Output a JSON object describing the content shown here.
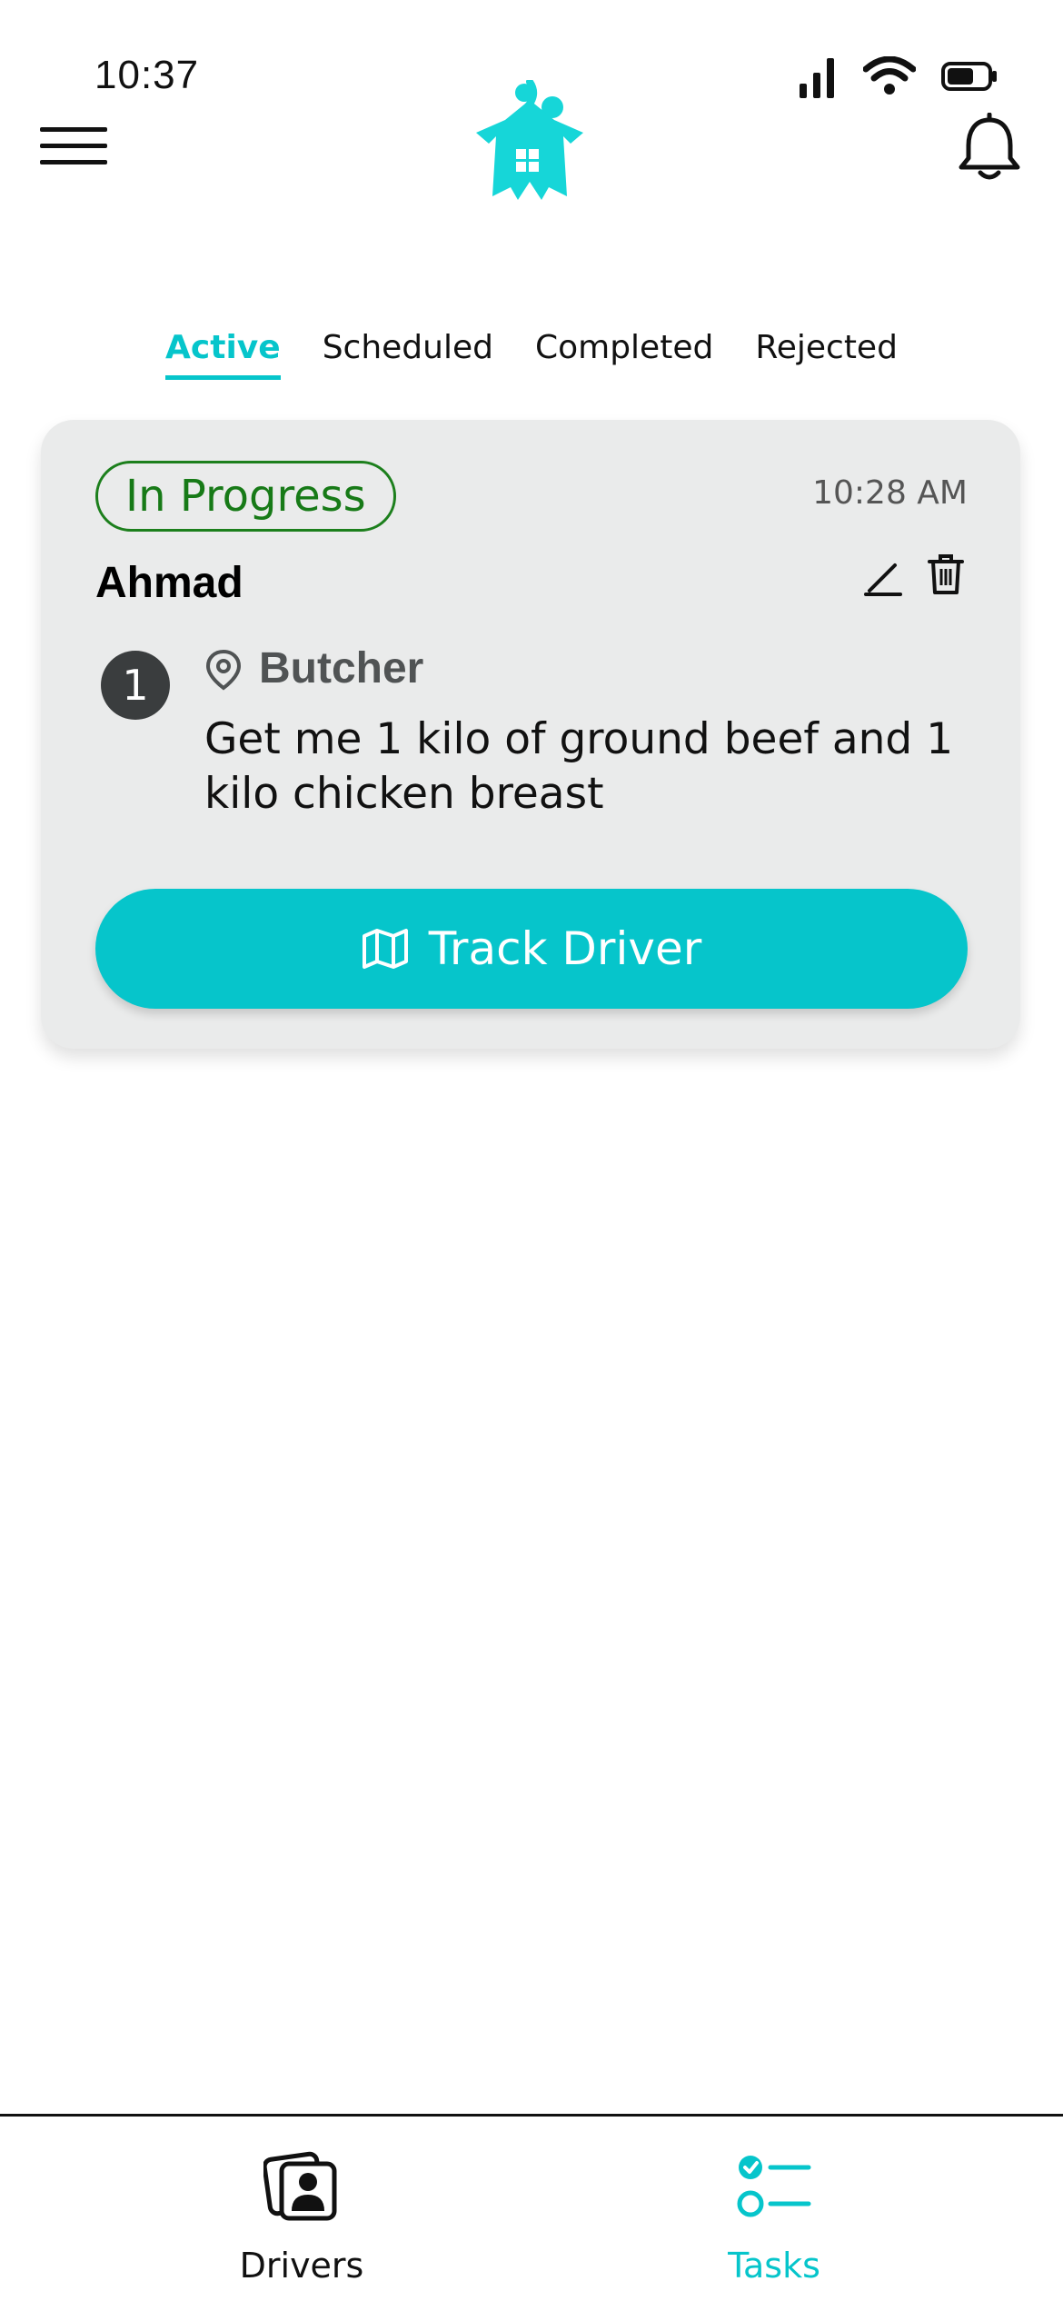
{
  "status_bar": {
    "time": "10:37"
  },
  "tabs": [
    {
      "label": "Active"
    },
    {
      "label": "Scheduled"
    },
    {
      "label": "Completed"
    },
    {
      "label": "Rejected"
    }
  ],
  "task_card": {
    "status": "In Progress",
    "time": "10:28 AM",
    "name": "Ahmad",
    "step_number": "1",
    "stop_name": "Butcher",
    "stop_description": "Get me 1 kilo of ground beef and 1 kilo chicken breast",
    "track_label": "Track Driver"
  },
  "bottom_nav": {
    "drivers_label": "Drivers",
    "tasks_label": "Tasks"
  },
  "colors": {
    "accent": "#06c5cb",
    "status_green": "#177a17",
    "card_bg": "#eaebeb"
  },
  "icons": [
    "signal-icon",
    "wifi-icon",
    "battery-icon",
    "menu-icon",
    "logo-icon",
    "bell-icon",
    "edit-icon",
    "trash-icon",
    "pin-icon",
    "map-icon",
    "drivers-icon",
    "tasks-icon"
  ]
}
